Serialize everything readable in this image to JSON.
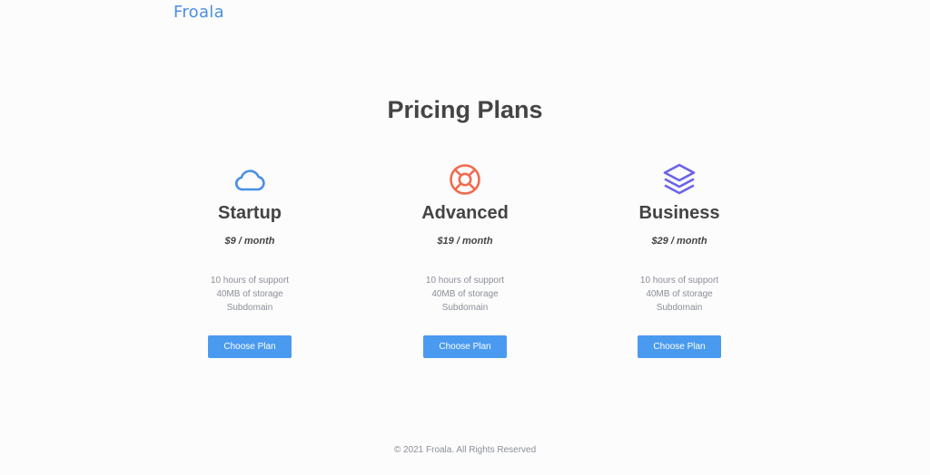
{
  "header": {
    "logo_text": "Froala"
  },
  "main": {
    "title": "Pricing Plans",
    "plans": [
      {
        "icon": "cloud-icon",
        "icon_color": "#4a90e2",
        "name": "Startup",
        "price": "$9 / month",
        "features": [
          "10 hours of support",
          "40MB of storage",
          "Subdomain"
        ],
        "button_label": "Choose Plan"
      },
      {
        "icon": "lifebuoy-icon",
        "icon_color": "#ef6b4e",
        "name": "Advanced",
        "price": "$19 / month",
        "features": [
          "10 hours of support",
          "40MB of storage",
          "Subdomain"
        ],
        "button_label": "Choose Plan"
      },
      {
        "icon": "layers-icon",
        "icon_color": "#6c63e9",
        "name": "Business",
        "price": "$29 / month",
        "features": [
          "10 hours of support",
          "40MB of storage",
          "Subdomain"
        ],
        "button_label": "Choose Plan"
      }
    ]
  },
  "footer": {
    "copyright": "© 2021 Froala. All Rights Reserved"
  },
  "colors": {
    "brand": "#4a90e2",
    "button": "#4a9af0",
    "heading": "#444444",
    "muted_text": "#8a8f99",
    "background": "#fcfcfc"
  }
}
